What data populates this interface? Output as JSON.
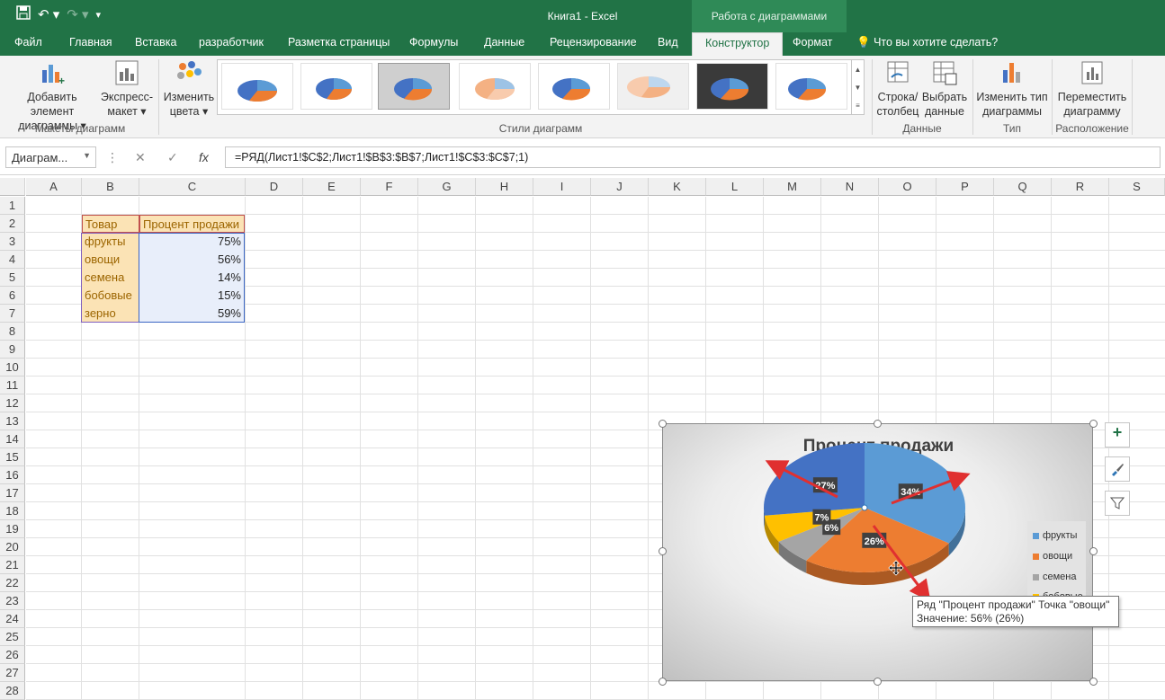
{
  "window": {
    "title": "Книга1 - Excel",
    "context_tab_group": "Работа с диаграммами"
  },
  "tabs": [
    {
      "label": "Файл"
    },
    {
      "label": "Главная"
    },
    {
      "label": "Вставка"
    },
    {
      "label": "разработчик"
    },
    {
      "label": "Разметка страницы"
    },
    {
      "label": "Формулы"
    },
    {
      "label": "Данные"
    },
    {
      "label": "Рецензирование"
    },
    {
      "label": "Вид"
    },
    {
      "label": "Конструктор"
    },
    {
      "label": "Формат"
    }
  ],
  "tellme": "Что вы хотите сделать?",
  "ribbon": {
    "add_element": {
      "l1": "Добавить элемент",
      "l2": "диаграммы ▾"
    },
    "quick_layout": {
      "l1": "Экспресс-",
      "l2": "макет ▾"
    },
    "change_colors": {
      "l1": "Изменить",
      "l2": "цвета ▾"
    },
    "switch_row_col": {
      "l1": "Строка/",
      "l2": "столбец"
    },
    "select_data": {
      "l1": "Выбрать",
      "l2": "данные"
    },
    "change_type": {
      "l1": "Изменить тип",
      "l2": "диаграммы"
    },
    "move_chart": {
      "l1": "Переместить",
      "l2": "диаграмму"
    },
    "groups": {
      "layouts": "Макеты диаграмм",
      "styles": "Стили диаграмм",
      "data": "Данные",
      "type": "Тип",
      "location": "Расположение"
    }
  },
  "formula_bar": {
    "name_box": "Диаграм...",
    "formula": "=РЯД(Лист1!$C$2;Лист1!$B$3:$B$7;Лист1!$C$3:$C$7;1)"
  },
  "columns": [
    "A",
    "B",
    "C",
    "D",
    "E",
    "F",
    "G",
    "H",
    "I",
    "J",
    "K",
    "L",
    "M",
    "N",
    "O",
    "P",
    "Q",
    "R",
    "S"
  ],
  "rows": [
    "1",
    "2",
    "3",
    "4",
    "5",
    "6",
    "7",
    "8",
    "9",
    "10",
    "11",
    "12",
    "13",
    "14",
    "15",
    "16",
    "17",
    "18",
    "19",
    "20",
    "21",
    "22",
    "23",
    "24",
    "25",
    "26",
    "27",
    "28"
  ],
  "table": {
    "header": [
      "Товар",
      "Процент продажи"
    ],
    "rows": [
      [
        "фрукты",
        "75%"
      ],
      [
        "овощи",
        "56%"
      ],
      [
        "семена",
        "14%"
      ],
      [
        "бобовые",
        "15%"
      ],
      [
        "зерно",
        "59%"
      ]
    ]
  },
  "chart_data": {
    "type": "pie",
    "title": "Процент продажи",
    "categories": [
      "фрукты",
      "овощи",
      "семена",
      "бобовые",
      "зерно"
    ],
    "values": [
      75,
      56,
      14,
      15,
      59
    ],
    "data_labels": [
      "34%",
      "26%",
      "6%",
      "7%",
      "27%"
    ],
    "colors": [
      "#5b9bd5",
      "#ed7d31",
      "#a5a5a5",
      "#ffc000",
      "#4472c4"
    ],
    "legend_position": "right",
    "legend_visible": [
      "фрукты",
      "овощи",
      "семена",
      "бобовые"
    ]
  },
  "tooltip": {
    "line1": "Ряд \"Процент продажи\" Точка \"овощи\"",
    "line2": "Значение: 56% (26%)"
  }
}
